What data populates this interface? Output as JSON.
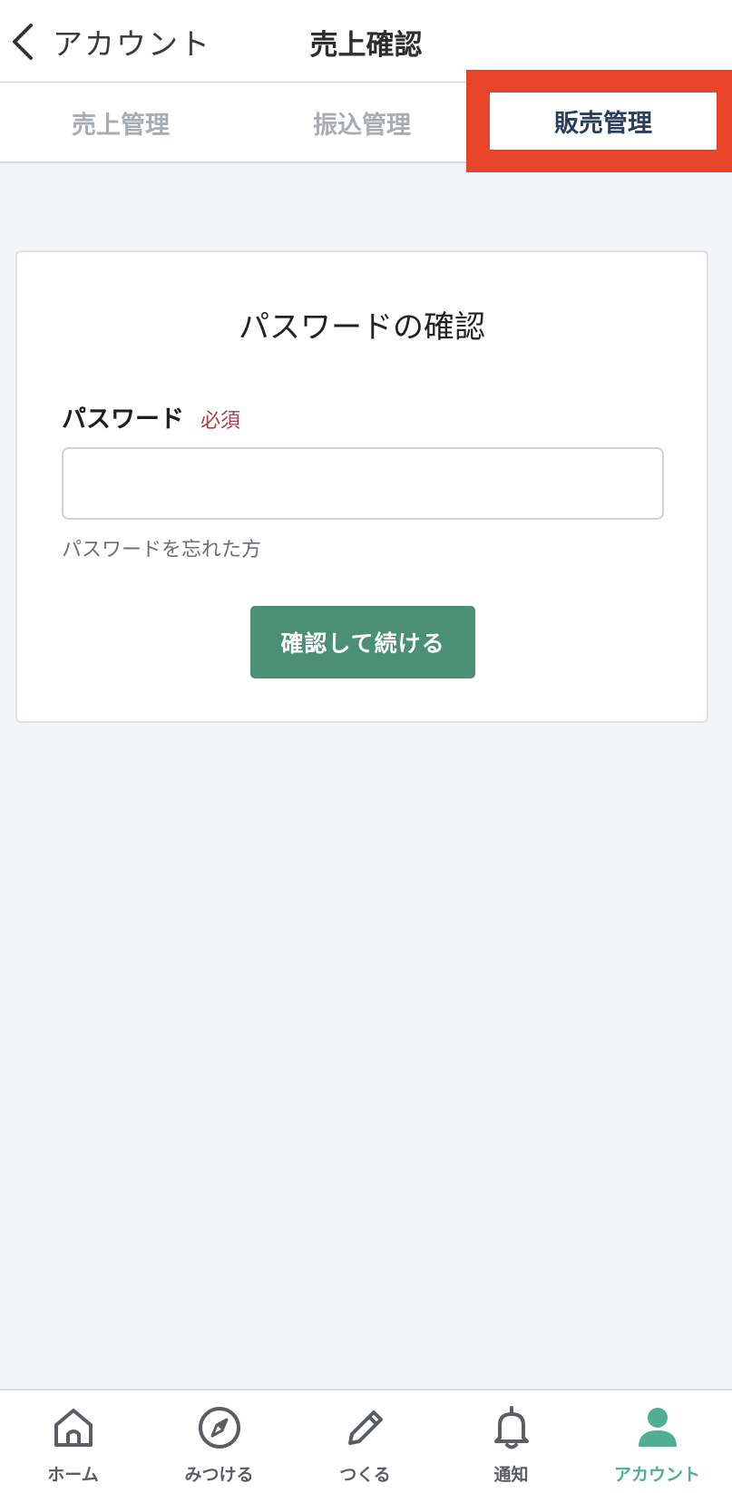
{
  "header": {
    "back_label": "アカウント",
    "title": "売上確認"
  },
  "tabs": [
    {
      "label": "売上管理",
      "active": false
    },
    {
      "label": "振込管理",
      "active": false
    },
    {
      "label": "販売管理",
      "active": true
    }
  ],
  "highlight_color": "#e8442a",
  "card": {
    "title": "パスワードの確認",
    "field_label": "パスワード",
    "required_badge": "必須",
    "password_value": "",
    "forgot_link": "パスワードを忘れた方",
    "confirm_button": "確認して続ける"
  },
  "bottom_nav": [
    {
      "label": "ホーム",
      "icon": "home-icon",
      "active": false
    },
    {
      "label": "みつける",
      "icon": "compass-icon",
      "active": false
    },
    {
      "label": "つくる",
      "icon": "pencil-icon",
      "active": false
    },
    {
      "label": "通知",
      "icon": "bell-icon",
      "active": false
    },
    {
      "label": "アカウント",
      "icon": "user-icon",
      "active": true
    }
  ],
  "colors": {
    "accent": "#4b8f74",
    "active_nav": "#4fae93",
    "required": "#b23a48"
  }
}
